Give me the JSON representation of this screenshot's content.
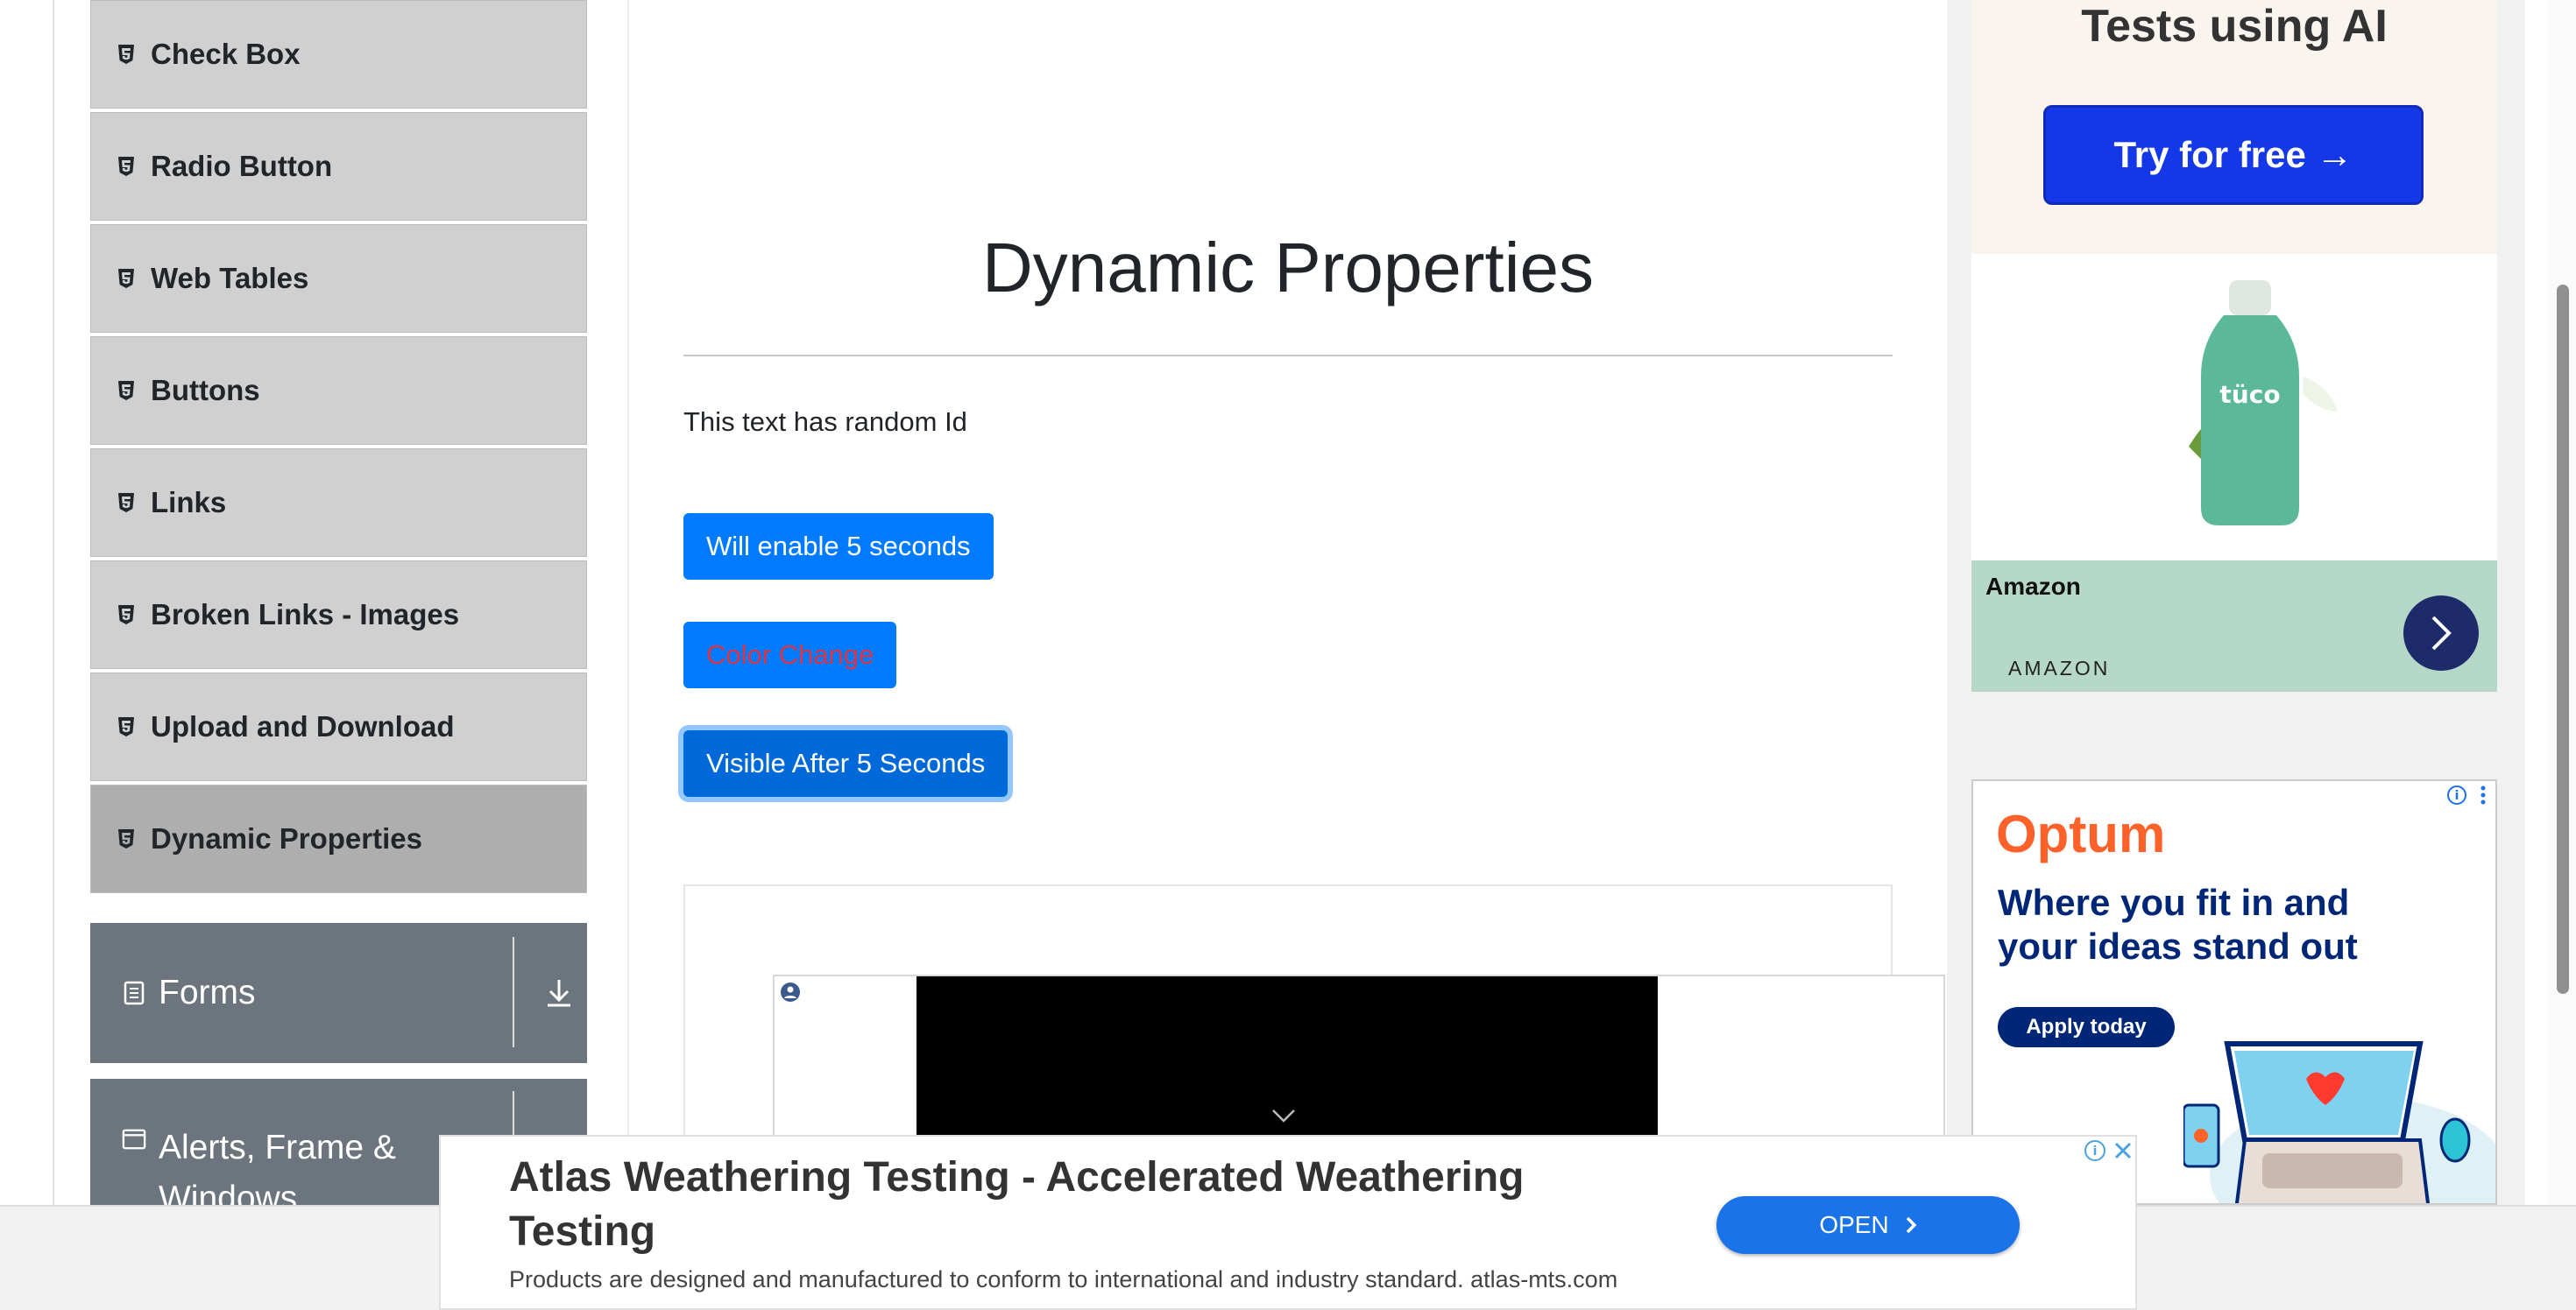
{
  "sidebar": {
    "items": [
      {
        "label": "Check Box"
      },
      {
        "label": "Radio Button"
      },
      {
        "label": "Web Tables"
      },
      {
        "label": "Buttons"
      },
      {
        "label": "Links"
      },
      {
        "label": "Broken Links - Images"
      },
      {
        "label": "Upload and Download"
      },
      {
        "label": "Dynamic Properties"
      }
    ],
    "groups": {
      "forms": "Forms",
      "alerts_line1": "Alerts, Frame &",
      "alerts_line2": "Windows"
    }
  },
  "main": {
    "title": "Dynamic Properties",
    "random_text": "This text has random Id",
    "enable_button": "Will enable 5 seconds",
    "color_button": "Color Change",
    "visible_button": "Visible After 5 Seconds"
  },
  "ads": {
    "ad1": {
      "headline": "Tests using AI",
      "button": "Try for free →"
    },
    "ad2": {
      "brand": "Amazon",
      "sub": "AMAZON"
    },
    "ad3": {
      "logo": "Optum",
      "headline": "Where you fit in and your ideas stand out",
      "button": "Apply today"
    }
  },
  "banner": {
    "title": "Atlas Weathering Testing - Accelerated Weathering Testing",
    "description": "Products are designed and manufactured to conform to international and industry standard. atlas-mts.com",
    "open": "OPEN"
  },
  "colors": {
    "primary": "#007bff",
    "sidebar_item": "#d0d0d0",
    "sidebar_active": "#aeaeae",
    "group": "#6c757d",
    "danger_text": "#dc3545"
  }
}
